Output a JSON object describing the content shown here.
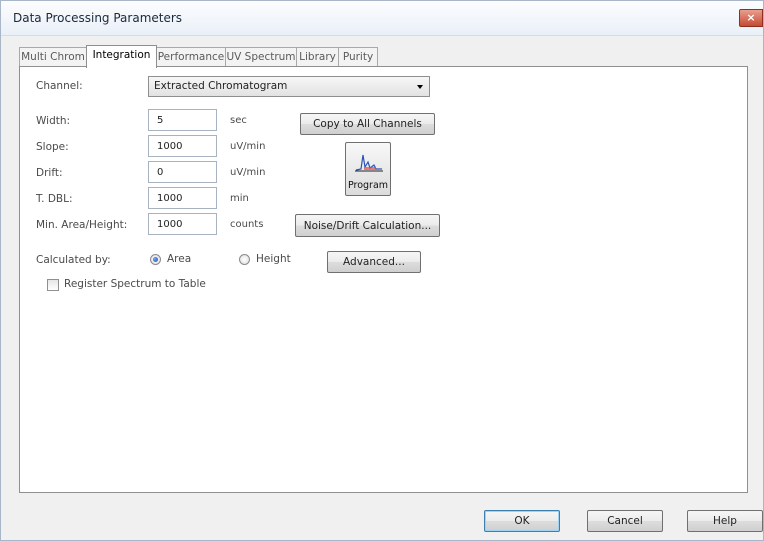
{
  "window": {
    "title": "Data Processing Parameters",
    "close_label": "×"
  },
  "tabs": [
    {
      "label": "Multi Chrom",
      "active": false
    },
    {
      "label": "Integration",
      "active": true
    },
    {
      "label": "Performance",
      "active": false
    },
    {
      "label": "UV Spectrum",
      "active": false
    },
    {
      "label": "Library",
      "active": false
    },
    {
      "label": "Purity",
      "active": false
    }
  ],
  "integration": {
    "channel": {
      "label": "Channel:",
      "value": "Extracted Chromatogram"
    },
    "params": [
      {
        "label": "Width:",
        "value": "5",
        "unit": "sec"
      },
      {
        "label": "Slope:",
        "value": "1000",
        "unit": "uV/min"
      },
      {
        "label": "Drift:",
        "value": "0",
        "unit": "uV/min"
      },
      {
        "label": "T. DBL:",
        "value": "1000",
        "unit": "min"
      },
      {
        "label": "Min. Area/Height:",
        "value": "1000",
        "unit": "counts"
      }
    ],
    "copy_button": "Copy to All Channels",
    "program_button": "Program",
    "noise_button": "Noise/Drift Calculation...",
    "calculated_by": {
      "label": "Calculated by:",
      "options": [
        {
          "label": "Area",
          "selected": true
        },
        {
          "label": "Height",
          "selected": false
        }
      ]
    },
    "advanced_button": "Advanced...",
    "register_spectrum": {
      "label": "Register Spectrum to Table",
      "checked": false
    }
  },
  "footer": {
    "ok": "OK",
    "cancel": "Cancel",
    "help": "Help"
  },
  "colors": {
    "accent": "#3c7fb1",
    "panel": "#ffffff",
    "window": "#f0f0f0"
  }
}
